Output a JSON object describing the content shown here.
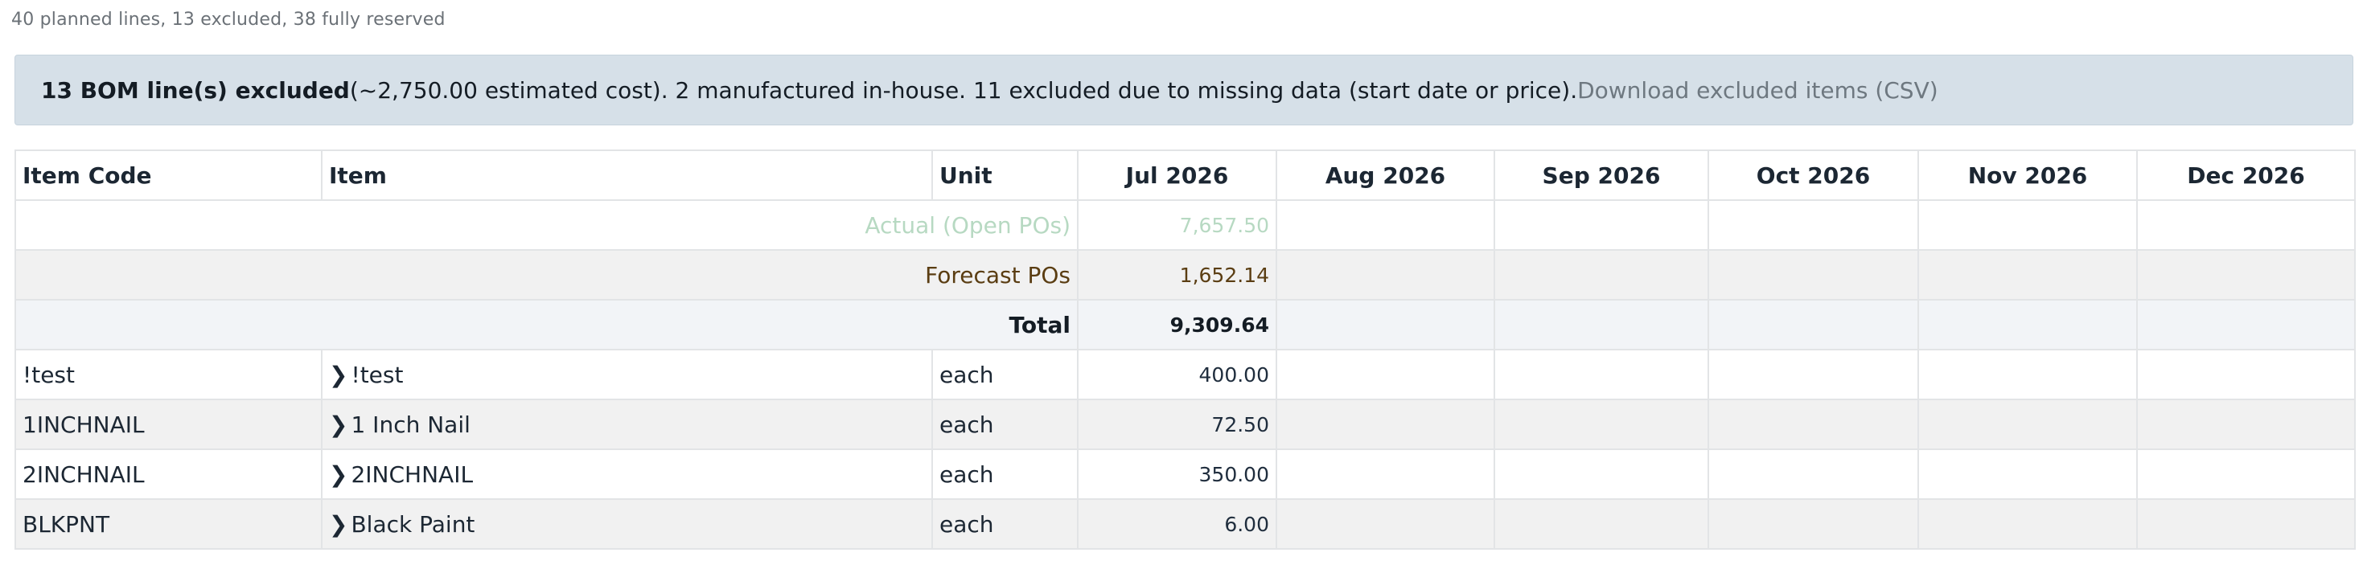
{
  "summary": "40 planned lines, 13 excluded, 38 fully reserved",
  "banner": {
    "strong": "13 BOM line(s) excluded",
    "text": " (~2,750.00 estimated cost). 2 manufactured in-house. 11 excluded due to missing data (start date or price). ",
    "link": "Download excluded items (CSV)"
  },
  "table": {
    "headers": {
      "item_code": "Item Code",
      "item": "Item",
      "unit": "Unit",
      "months": [
        "Jul 2026",
        "Aug 2026",
        "Sep 2026",
        "Oct 2026",
        "Nov 2026",
        "Dec 2026"
      ]
    },
    "summary_rows": {
      "actual": {
        "label": "Actual (Open POs)",
        "jul": "7,657.50"
      },
      "forecast": {
        "label": "Forecast POs",
        "jul": "1,652.14"
      },
      "total": {
        "label": "Total",
        "jul": "9,309.64"
      }
    },
    "rows": [
      {
        "code": "!test",
        "chevron": "❯",
        "name": "!test",
        "unit": "each",
        "jul": "400.00"
      },
      {
        "code": "1INCHNAIL",
        "chevron": "❯",
        "name": "1 Inch Nail",
        "unit": "each",
        "jul": "72.50"
      },
      {
        "code": "2INCHNAIL",
        "chevron": "❯",
        "name": "2INCHNAIL",
        "unit": "each",
        "jul": "350.00"
      },
      {
        "code": "BLKPNT",
        "chevron": "❯",
        "name": "Black Paint",
        "unit": "each",
        "jul": "6.00"
      }
    ]
  }
}
